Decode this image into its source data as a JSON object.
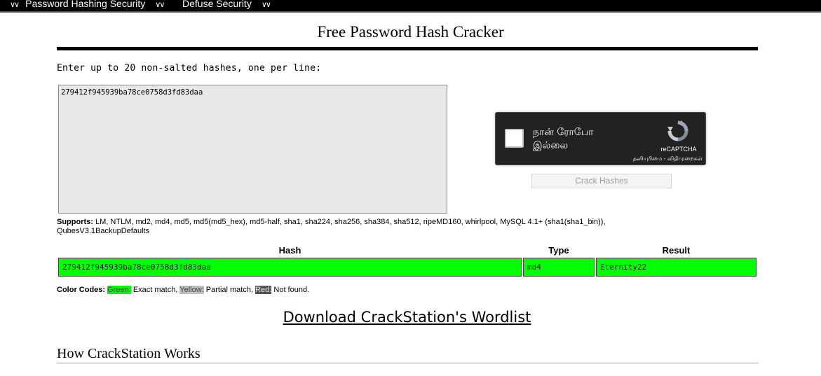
{
  "nav": {
    "items": [
      {
        "label": "Password Hashing Security",
        "chevron": "»"
      },
      {
        "label": "Defuse Security",
        "chevron": "»"
      }
    ]
  },
  "page": {
    "title": "Free Password Hash Cracker",
    "instructions": "Enter up to 20 non-salted hashes, one per line:"
  },
  "form": {
    "hashes_value": "279412f945939ba78ce0758d3fd83daa",
    "crack_button_label": "Crack Hashes"
  },
  "recaptcha": {
    "label_line1": "நான் ரோபோ",
    "label_line2": "இல்லை",
    "brand": "reCAPTCHA",
    "links": "தனியுரிமை - விதிமுறைகள்"
  },
  "supports": {
    "label": "Supports:",
    "text": "LM, NTLM, md2, md4, md5, md5(md5_hex), md5-half, sha1, sha224, sha256, sha384, sha512, ripeMD160, whirlpool, MySQL 4.1+ (sha1(sha1_bin)), QubesV3.1BackupDefaults"
  },
  "results": {
    "headers": {
      "hash": "Hash",
      "type": "Type",
      "result": "Result"
    },
    "rows": [
      {
        "hash": "279412f945939ba78ce0758d3fd83daa",
        "type": "md4",
        "result": "Eternity22",
        "status": "exact"
      }
    ]
  },
  "color_codes": {
    "label": "Color Codes:",
    "green": "Green:",
    "green_desc": " Exact match, ",
    "yellow": "Yellow:",
    "yellow_desc": " Partial match, ",
    "red": "Red:",
    "red_desc": " Not found."
  },
  "colors": {
    "exact": "#00ff00",
    "partial": "#bdbdbd",
    "not_found": "#555555"
  },
  "download": {
    "label": "Download CrackStation's Wordlist"
  },
  "how": {
    "heading": "How CrackStation Works"
  }
}
